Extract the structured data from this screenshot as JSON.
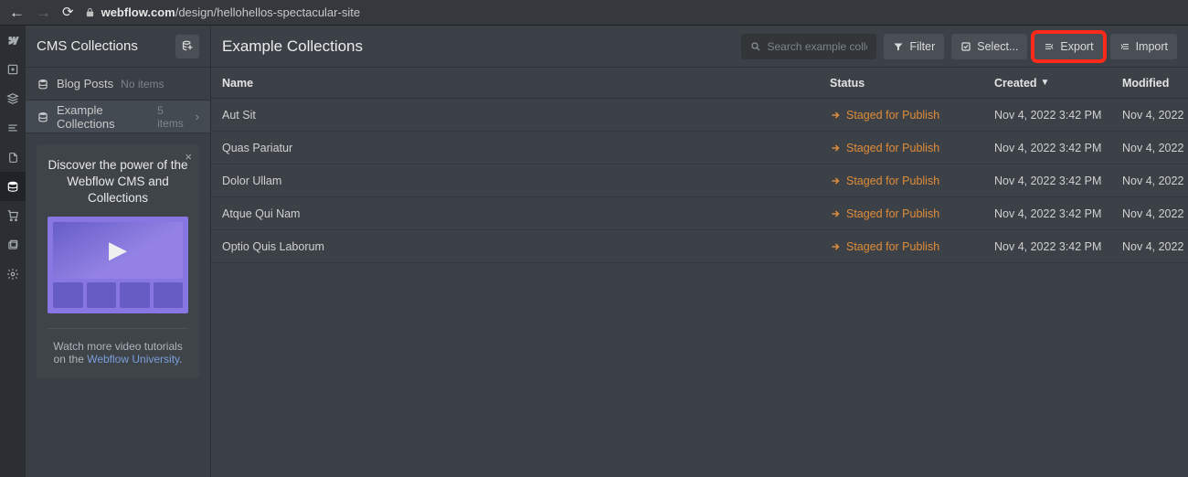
{
  "browser": {
    "url_host": "webflow.com",
    "url_path": "/design/hellohellos-spectacular-site"
  },
  "sidebar_title": "CMS Collections",
  "collections": [
    {
      "name": "Blog Posts",
      "meta": "No items",
      "active": false
    },
    {
      "name": "Example Collections",
      "meta": "5 items",
      "active": true
    }
  ],
  "promo": {
    "title": "Discover the power of the Webflow CMS and Collections",
    "footer_text": "Watch more video tutorials on the ",
    "footer_link": "Webflow University",
    "close": "×"
  },
  "main": {
    "title": "Example Collections",
    "search_placeholder": "Search example collections",
    "buttons": {
      "filter": "Filter",
      "select": "Select...",
      "export": "Export",
      "import": "Import"
    },
    "columns": {
      "name": "Name",
      "status": "Status",
      "created": "Created",
      "modified": "Modified"
    },
    "rows": [
      {
        "name": "Aut Sit",
        "status": "Staged for Publish",
        "created": "Nov 4, 2022 3:42 PM",
        "modified": "Nov 4, 2022"
      },
      {
        "name": "Quas Pariatur",
        "status": "Staged for Publish",
        "created": "Nov 4, 2022 3:42 PM",
        "modified": "Nov 4, 2022"
      },
      {
        "name": "Dolor Ullam",
        "status": "Staged for Publish",
        "created": "Nov 4, 2022 3:42 PM",
        "modified": "Nov 4, 2022"
      },
      {
        "name": "Atque Qui Nam",
        "status": "Staged for Publish",
        "created": "Nov 4, 2022 3:42 PM",
        "modified": "Nov 4, 2022"
      },
      {
        "name": "Optio Quis Laborum",
        "status": "Staged for Publish",
        "created": "Nov 4, 2022 3:42 PM",
        "modified": "Nov 4, 2022"
      }
    ]
  }
}
